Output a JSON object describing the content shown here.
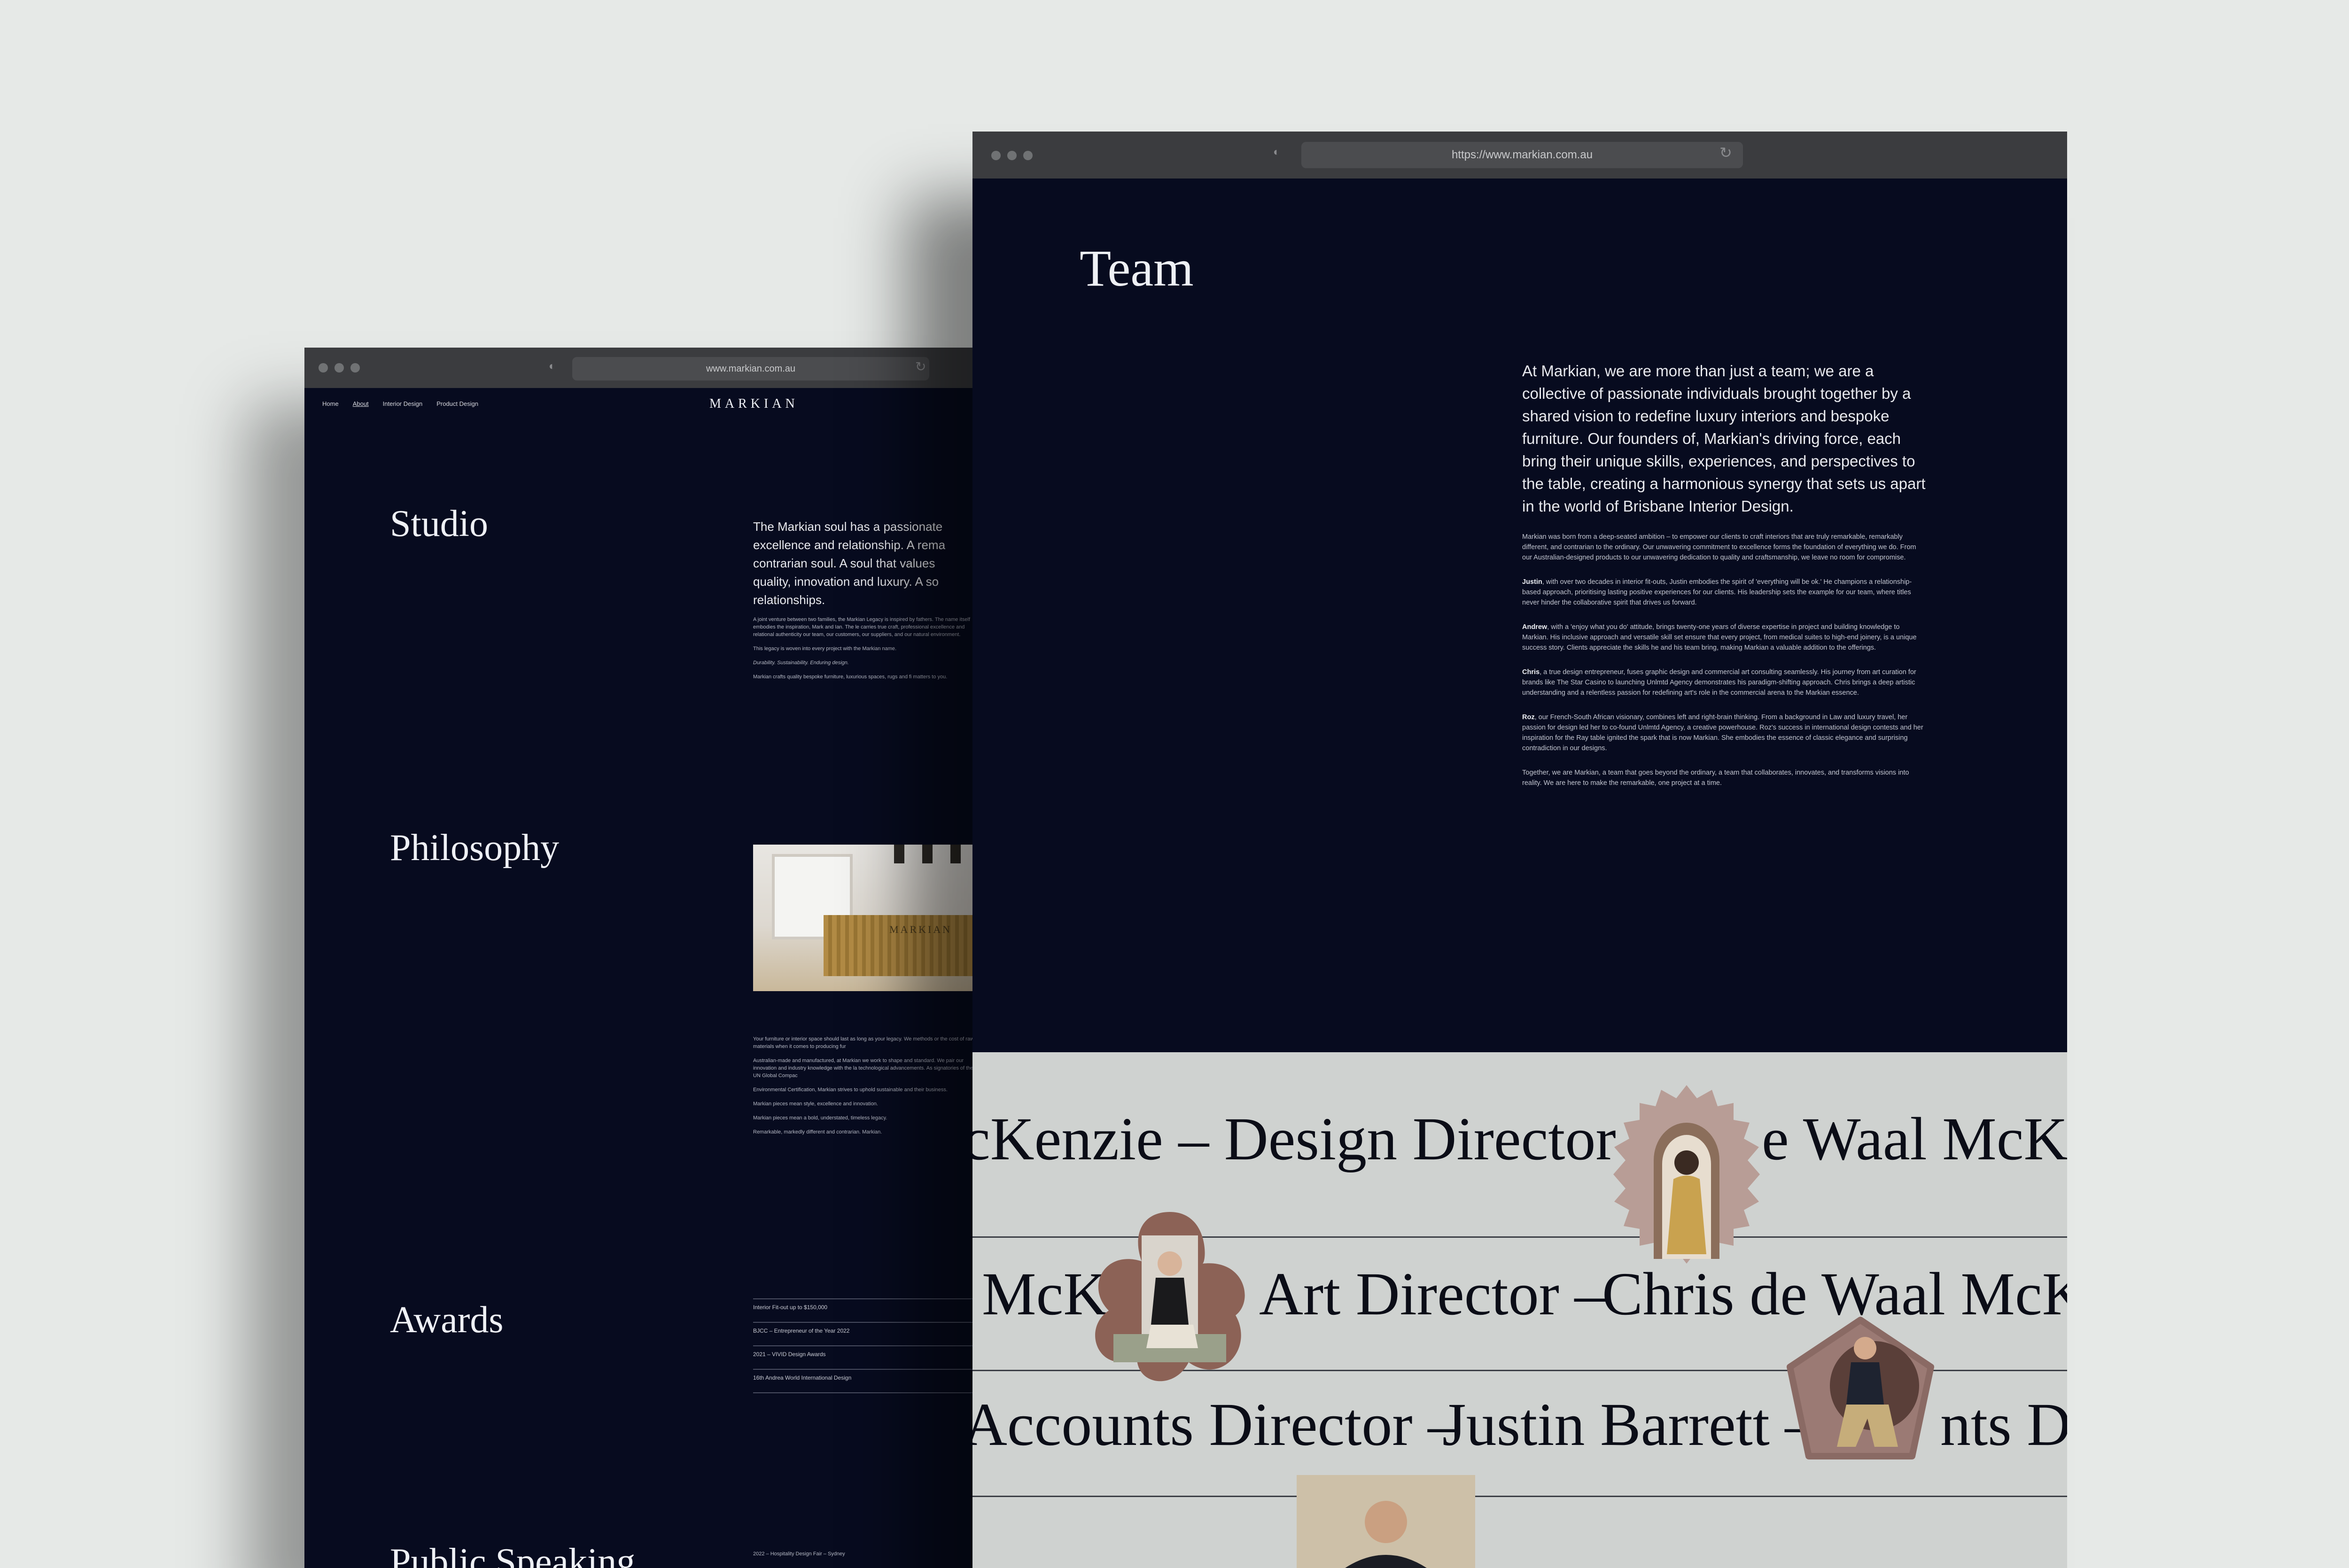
{
  "left_window": {
    "url": "www.markian.com.au",
    "nav": [
      "Home",
      "About",
      "Interior Design",
      "Product Design"
    ],
    "logo": "MARKIAN",
    "studio": {
      "title": "Studio",
      "lead": "The Markian soul has a passionate excellence and relationship. A rema contrarian soul. A soul that values quality, innovation and luxury. A so relationships.",
      "p1": "A joint venture between two families, the Markian Legacy is inspired by fathers. The name itself embodies the inspiration, Mark and Ian. The le carries true craft, professional excellence and relational authenticity our team, our customers, our suppliers, and our natural environment.",
      "p2": "This legacy is woven into every project with the Markian name.",
      "p3": "Durability. Sustainability. Enduring design.",
      "p4": "Markian crafts quality bespoke furniture, luxurious spaces, rugs and fi matters to you."
    },
    "philosophy": {
      "title": "Philosophy",
      "photo_brand": "MARKIAN",
      "p1": "Your furniture or interior space should last as long as your legacy. We methods or the cost of raw materials when it comes to producing fur",
      "p2": "Australian-made and manufactured, at Markian we work to shape and standard. We pair our innovation and industry knowledge with the la technological advancements. As signatories of the UN Global Compac",
      "p3": "Environmental Certification, Markian strives to uphold sustainable and their business.",
      "p4": "Markian pieces mean style, excellence and innovation.",
      "p5": "Markian pieces mean a bold, understated, timeless legacy.",
      "p6": "Remarkable, markedly different and contrarian. Markian."
    },
    "awards": {
      "title": "Awards",
      "items": [
        "Interior Fit-out up to $150,000",
        "BJCC – Entrepreneur of the Year 2022",
        "2021 – VIVID Design Awards",
        "16th Andrea World International Design"
      ]
    },
    "public_speaking": {
      "title": "Public Speaking",
      "first_item": "2022 – Hospitality Design Fair – Sydney"
    }
  },
  "right_window": {
    "url": "https://www.markian.com.au",
    "title": "Team",
    "lead": "At Markian, we are more than just a team; we are a collective of passionate individuals brought together by a shared vision to redefine luxury interiors and bespoke furniture. Our founders of, Markian's driving force, each bring their unique skills, experiences, and perspectives to the table, creating a harmonious synergy that sets us apart in the world of Brisbane Interior Design.",
    "p_intro": "Markian was born from a deep-seated ambition – to empower our clients to craft interiors that are truly remarkable, remarkably different, and contrarian to the ordinary. Our unwavering commitment to excellence forms the foundation of everything we do. From our Australian-designed products to our unwavering dedication to quality and craftsmanship, we leave no room for compromise.",
    "justin_name": "Justin",
    "justin_text": ", with over two decades in interior fit-outs, Justin embodies the spirit of 'everything will be ok.' He champions a relationship-based approach, prioritising lasting positive experiences for our clients. His leadership sets the example for our team, where titles never hinder the collaborative spirit that drives us forward.",
    "andrew_name": "Andrew",
    "andrew_text": ", with a 'enjoy what you do' attitude, brings twenty-one years of diverse expertise in project and building knowledge to Markian. His inclusive approach and versatile skill set ensure that every project, from medical suites to high-end joinery, is a unique success story. Clients appreciate the skills he and his team bring, making Markian a valuable addition to the offerings.",
    "chris_name": "Chris",
    "chris_text": ", a true design entrepreneur, fuses graphic design and commercial art consulting seamlessly. His journey from art curation for brands like The Star Casino to launching Unlmtd Agency demonstrates his paradigm-shifting approach. Chris brings a deep artistic understanding and a relentless passion for redefining art's role in the commercial arena to the Markian essence.",
    "roz_name": "Roz",
    "roz_text": ", our French-South African visionary, combines left and right-brain thinking. From a background in Law and luxury travel, her passion for design led her to co-found Unlmtd Agency, a creative powerhouse. Roz's success in international design contests and her inspiration for the Ray table ignited the spark that is now Markian. She embodies the essence of classic elegance and surprising contradiction in our designs.",
    "p_outro": "Together, we are Markian, a team that goes beyond the ordinary, a team that collaborates, innovates, and transforms visions into reality. We are here to make the remarkable, one project at a time.",
    "marquee": {
      "row1_a": "cKenzie – Design Director –",
      "row1_b": "e Waal McKen",
      "row2_a": "McK",
      "row2_b": "Art Director –",
      "row2_c": "Chris de Waal McKe",
      "row3_a": "Accounts Director –",
      "row3_b": "Justin Barrett –",
      "row3_c": "nts D"
    }
  }
}
